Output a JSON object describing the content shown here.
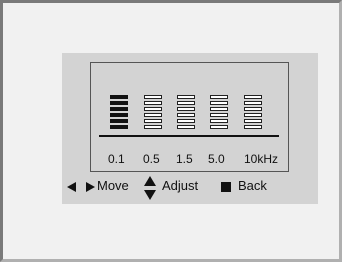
{
  "equalizer": {
    "bands": [
      {
        "label": "0.1",
        "level": 6,
        "max": 6
      },
      {
        "label": "0.5",
        "level": 0,
        "max": 6
      },
      {
        "label": "1.5",
        "level": 0,
        "max": 6
      },
      {
        "label": "5.0",
        "level": 0,
        "max": 6
      },
      {
        "label": "10kHz",
        "level": 0,
        "max": 6
      }
    ]
  },
  "hints": {
    "move_label": "Move",
    "adjust_label": "Adjust",
    "back_label": "Back"
  },
  "colors": {
    "panel": "#d3d3d3",
    "frame": "#f1f1f1",
    "filled_segment": "#111111",
    "empty_segment": "#ffffff"
  }
}
